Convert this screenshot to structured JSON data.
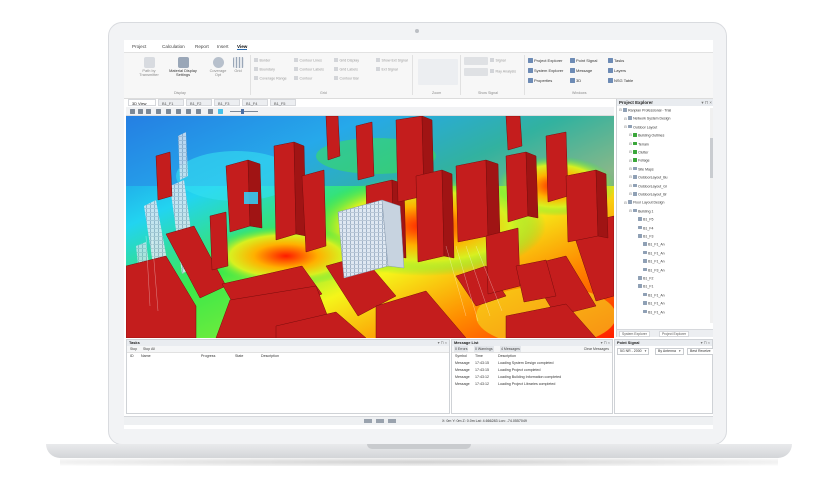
{
  "ribbon_tabs": [
    "Project",
    "Calculation",
    "Report",
    "Insert",
    "View"
  ],
  "ribbon": {
    "buttons_large": [
      "Path by Transmitter",
      "Material Display Settings",
      "Coverage Opt",
      "Grid"
    ],
    "small_col1": [
      "Border",
      "Boundary",
      "Coverage Range"
    ],
    "small_col2": [
      "Contour Lines",
      "Contour Labels",
      "Contour"
    ],
    "small_col3": [
      "Grid Display",
      "Grid Labels",
      "Contour Bar"
    ],
    "small_col4": [
      "Show Ext Signal",
      "Ext Signal"
    ],
    "group_labels": [
      "Display",
      "Grid",
      "Zoom",
      "Show Signal",
      "Windows"
    ],
    "show_signal_labels": [
      "Signal",
      "Ray Analysis"
    ],
    "windows_col1": [
      "Project Explorer",
      "System Explorer",
      "Properties"
    ],
    "windows_col2": [
      "Point Signal",
      "Message",
      "3D"
    ],
    "windows_col3": [
      "Tasks",
      "Layers",
      "NSG Table"
    ]
  },
  "view_tabs": [
    "3D View",
    "B1_F1",
    "B1_F2",
    "B1_F3",
    "B1_F4",
    "B1_F5"
  ],
  "explorer": {
    "title": "Project Explorer",
    "items": [
      {
        "label": "Ranplan Professional - Trial",
        "level": 0,
        "kind": "icon"
      },
      {
        "label": "Network System Design",
        "level": 1,
        "kind": "icon"
      },
      {
        "label": "Outdoor Layout",
        "level": 1,
        "kind": "icon"
      },
      {
        "label": "Building Outlines",
        "level": 2,
        "kind": "check"
      },
      {
        "label": "Terrain",
        "level": 2,
        "kind": "check"
      },
      {
        "label": "Clutter",
        "level": 2,
        "kind": "check"
      },
      {
        "label": "Foliage",
        "level": 2,
        "kind": "check"
      },
      {
        "label": "Site Maps",
        "level": 2,
        "kind": "icon"
      },
      {
        "label": "OutdoorLayout_Bu",
        "level": 2,
        "kind": "icon"
      },
      {
        "label": "OutdoorLayout_Gr",
        "level": 2,
        "kind": "icon"
      },
      {
        "label": "OutdoorLayout_Br",
        "level": 2,
        "kind": "icon"
      },
      {
        "label": "Floor Layout Design",
        "level": 1,
        "kind": "icon"
      },
      {
        "label": "Building 1",
        "level": 2,
        "kind": "icon"
      },
      {
        "label": "B1_F5",
        "level": 3,
        "kind": "icon"
      },
      {
        "label": "B1_F4",
        "level": 3,
        "kind": "icon"
      },
      {
        "label": "B1_F3",
        "level": 3,
        "kind": "icon"
      },
      {
        "label": "B1_F1_An",
        "level": 4,
        "kind": "icon"
      },
      {
        "label": "B1_F1_An",
        "level": 4,
        "kind": "icon"
      },
      {
        "label": "B1_F1_An",
        "level": 4,
        "kind": "icon"
      },
      {
        "label": "B1_F3_An",
        "level": 4,
        "kind": "icon"
      },
      {
        "label": "B1_F2",
        "level": 3,
        "kind": "icon"
      },
      {
        "label": "B1_F1",
        "level": 3,
        "kind": "icon"
      },
      {
        "label": "B1_F1_An",
        "level": 4,
        "kind": "icon"
      },
      {
        "label": "B1_F1_An",
        "level": 4,
        "kind": "icon"
      },
      {
        "label": "B1_F1_An",
        "level": 4,
        "kind": "icon"
      }
    ],
    "bottom_tabs": [
      "System Explorer",
      "Project Explorer"
    ]
  },
  "tasks": {
    "title": "Tasks",
    "toolbar": [
      "Stop",
      "Stop All"
    ],
    "columns": [
      "ID",
      "Name",
      "Progress",
      "State",
      "Description"
    ]
  },
  "messages": {
    "title": "Message List",
    "filters": [
      "0 Errors",
      "0 Warnings",
      "4 Messages"
    ],
    "clear_label": "Clear Messages",
    "columns": [
      "Symbol",
      "Time",
      "Description"
    ],
    "rows": [
      [
        "Message",
        "17:43:15",
        "Loading System Design completed"
      ],
      [
        "Message",
        "17:43:15",
        "Loading Project completed"
      ],
      [
        "Message",
        "17:43:12",
        "Loading Building Information completed"
      ],
      [
        "Message",
        "17:43:12",
        "Loading Project Libraries completed"
      ]
    ]
  },
  "point_signal": {
    "title": "Point Signal",
    "select1": "5G NR - 2000",
    "select2": "By Antenna",
    "select3": "Best Receive"
  },
  "status_bar": "X: 0m  Y: 0m  Z: 0.0m  Lat: 4.666283  Lon: -74.0557049",
  "colors": {
    "accent": "#2b6cb0",
    "building": "#c41d1d",
    "heatmap_low": "#2a7de0",
    "heatmap_high": "#ff2a00"
  }
}
